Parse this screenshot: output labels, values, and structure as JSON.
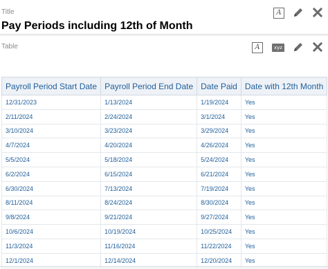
{
  "title_view": {
    "label": "Title",
    "heading": "Pay Periods including 12th of Month",
    "icons": {
      "format": "A"
    }
  },
  "table_view": {
    "label": "Table",
    "icons": {
      "format": "A",
      "view": "xyz"
    },
    "columns": [
      "Payroll Period Start Date",
      "Payroll Period End Date",
      "Date Paid",
      "Date with 12th Month"
    ],
    "rows": [
      [
        "12/31/2023",
        "1/13/2024",
        "1/19/2024",
        "Yes"
      ],
      [
        "2/11/2024",
        "2/24/2024",
        "3/1/2024",
        "Yes"
      ],
      [
        "3/10/2024",
        "3/23/2024",
        "3/29/2024",
        "Yes"
      ],
      [
        "4/7/2024",
        "4/20/2024",
        "4/26/2024",
        "Yes"
      ],
      [
        "5/5/2024",
        "5/18/2024",
        "5/24/2024",
        "Yes"
      ],
      [
        "6/2/2024",
        "6/15/2024",
        "6/21/2024",
        "Yes"
      ],
      [
        "6/30/2024",
        "7/13/2024",
        "7/19/2024",
        "Yes"
      ],
      [
        "8/11/2024",
        "8/24/2024",
        "8/30/2024",
        "Yes"
      ],
      [
        "9/8/2024",
        "9/21/2024",
        "9/27/2024",
        "Yes"
      ],
      [
        "10/6/2024",
        "10/19/2024",
        "10/25/2024",
        "Yes"
      ],
      [
        "11/3/2024",
        "11/16/2024",
        "11/22/2024",
        "Yes"
      ],
      [
        "12/1/2024",
        "12/14/2024",
        "12/20/2024",
        "Yes"
      ]
    ]
  },
  "colors": {
    "link_text": "#1f5d99",
    "header_bg": "#eef2f7"
  }
}
